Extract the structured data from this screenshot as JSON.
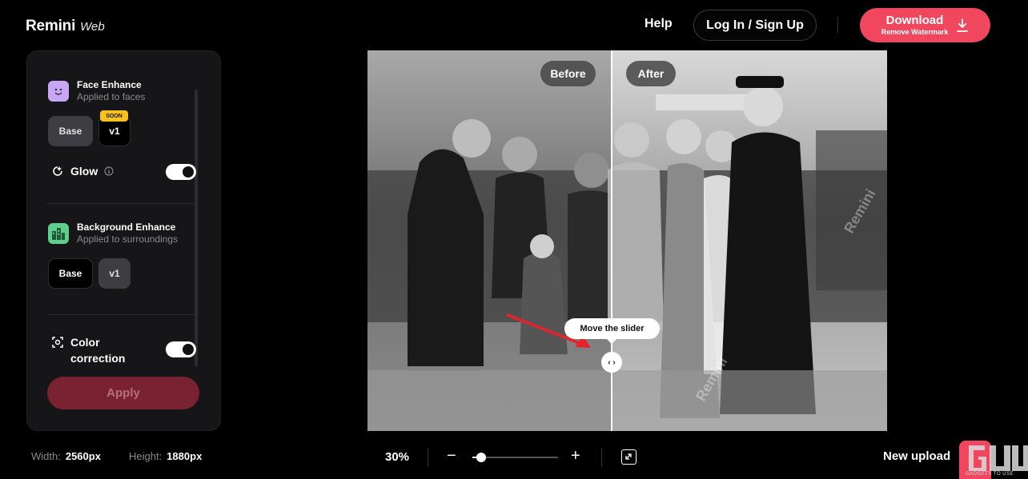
{
  "brand": {
    "name": "Remini",
    "sub": "Web"
  },
  "header": {
    "help": "Help",
    "login": "Log In / Sign Up",
    "download_title": "Download",
    "download_sub": "Remove Watermark"
  },
  "sidebar": {
    "face": {
      "title": "Face Enhance",
      "subtitle": "Applied to faces",
      "options": [
        "Base",
        "v1"
      ],
      "selected": "Base",
      "badge": "SOON"
    },
    "glow": {
      "label": "Glow",
      "enabled": true
    },
    "background": {
      "title": "Background Enhance",
      "subtitle": "Applied to surroundings",
      "options": [
        "Base",
        "v1"
      ],
      "selected": "v1"
    },
    "color": {
      "label_line1": "Color",
      "label_line2": "correction",
      "enabled": true
    },
    "apply_label": "Apply"
  },
  "dims": {
    "width_label": "Width:",
    "width_value": "2560px",
    "height_label": "Height:",
    "height_value": "1880px"
  },
  "viewer": {
    "before_label": "Before",
    "after_label": "After",
    "tooltip": "Move the slider",
    "watermark": "Remini",
    "slider_position": 0.47
  },
  "bottom": {
    "zoom": "30%",
    "zoom_fraction": 0.1,
    "new_upload": "New upload",
    "corner_watermark": "GADGETS TO USE"
  },
  "colors": {
    "accent": "#f0475f",
    "panel": "#161618",
    "apply_disabled": "#7a2232",
    "soon": "#f8c21a"
  }
}
